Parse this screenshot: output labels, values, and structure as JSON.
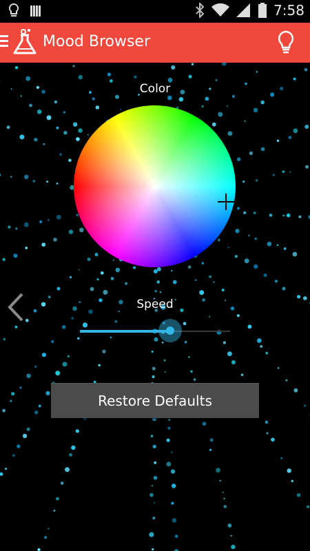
{
  "status_bar": {
    "time": "7:58",
    "icons_left": [
      "lightbulb-icon",
      "signal-bars-icon"
    ],
    "icons_right": [
      "bluetooth-icon",
      "wifi-icon",
      "cell-signal-icon",
      "battery-icon"
    ]
  },
  "app_bar": {
    "title": "Mood Browser",
    "color": "#f0483c",
    "menu_icon": "hamburger-icon",
    "logo_icon": "flask-icon",
    "action_icon": "lightbulb-icon"
  },
  "color_picker": {
    "label": "Color"
  },
  "speed": {
    "label": "Speed",
    "value": 0.6,
    "accent": "#33b5e5"
  },
  "restore_button": {
    "label": "Restore Defaults"
  },
  "navigation": {
    "back_icon": "chevron-left-icon"
  }
}
